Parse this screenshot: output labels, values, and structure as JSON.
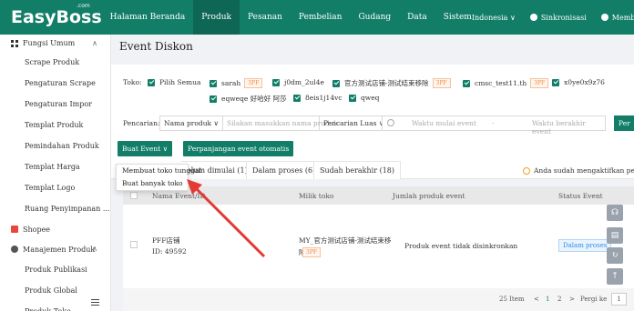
{
  "app": {
    "logo": "EasyBoss",
    "logo_com": ".com"
  },
  "topnav": {
    "items": [
      "Halaman Beranda",
      "Produk",
      "Pesanan",
      "Pembelian",
      "Gudang",
      "Data",
      "Sistem"
    ],
    "active": "Produk",
    "language": "Indonesia",
    "sync": "Sinkronisasi",
    "help": "Membantu"
  },
  "sidebar": {
    "group1": "Fungsi Umum",
    "group1_items": [
      "Scrape Produk",
      "Pengaturan Scrape",
      "Pengaturan Impor",
      "Templat Produk",
      "Pemindahan Produk",
      "Templat Harga",
      "Templat Logo",
      "Ruang Penyimpanan ..."
    ],
    "shopee": "Shopee",
    "group2": "Manajemen Produk",
    "group2_items": [
      "Produk Publikasi",
      "Produk Global",
      "Produk Toko"
    ]
  },
  "page": {
    "title": "Event Diskon"
  },
  "filter": {
    "toko_label": "Toko:",
    "select_all": "Pilih Semua",
    "stores": [
      {
        "name": "sarah",
        "tag": "3PF"
      },
      {
        "name": "j0dm_2ul4e",
        "tag": ""
      },
      {
        "name": "官方测试店铺-测试结束移除",
        "tag": "3PF"
      },
      {
        "name": "cmsc_test11.th",
        "tag": "3PF"
      },
      {
        "name": "x0ye0x9z76",
        "tag": ""
      },
      {
        "name": "eqweqe 好哈好 阿莎",
        "tag": ""
      },
      {
        "name": "8eis1j14vc",
        "tag": ""
      },
      {
        "name": "qweq",
        "tag": ""
      }
    ],
    "search_label": "Pencarian:",
    "search_field": "Nama produk",
    "search_placeholder": "Silakan masukkan nama produk",
    "search_mode": "Pencarian Luas",
    "date_start": "Waktu mulai event",
    "date_sep": "-",
    "date_end": "Waktu berakhir event",
    "search_button": "Per"
  },
  "actions": {
    "create_event": "Buat Event",
    "extend_event": "Perpanjangan event otomatis",
    "dropdown": [
      "Membuat toko tunggal",
      "Buat banyak toko"
    ]
  },
  "tabs": [
    {
      "label": "elum dimulai (1)"
    },
    {
      "label": "Dalam proses (6)"
    },
    {
      "label": "Sudah berakhir (18)"
    }
  ],
  "warning": "Anda sudah mengaktifkan perpar",
  "table": {
    "headers": [
      "Nama Event/ID",
      "Milik toko",
      "Jumlah produk event",
      "Status Event"
    ],
    "rows": [
      {
        "name": "PFF店铺",
        "id": "ID: 49592",
        "store": "MY_官方测试店铺-测试结束移",
        "store2": "除",
        "tag": "3PF",
        "products": "Produk event tidak disinkronkan",
        "status": "Dalam proses"
      }
    ]
  },
  "pager": {
    "total": "25 Item",
    "prev": "<",
    "page1": "1",
    "page2": "2",
    "next": ">",
    "goto": "Pergi ke",
    "input": "1"
  },
  "colors": {
    "brand": "#127e68",
    "arrow": "#e53935"
  }
}
